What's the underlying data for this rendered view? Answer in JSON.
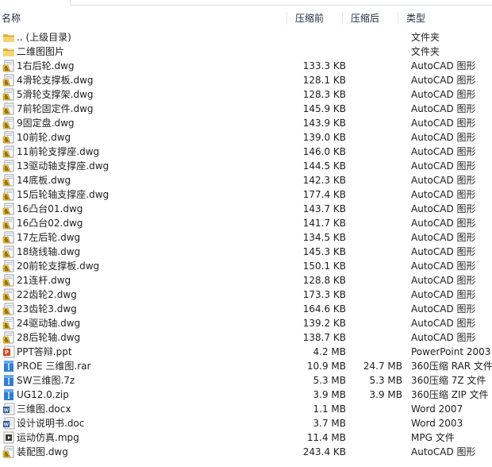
{
  "header": {
    "name": "名称",
    "size_before": "压缩前",
    "size_after": "压缩后",
    "type": "类型"
  },
  "rows": [
    {
      "name": ".. (上级目录)",
      "before": "",
      "after": "",
      "type": "文件夹",
      "icon": "folder-icon"
    },
    {
      "name": "二维图图片",
      "before": "",
      "after": "",
      "type": "文件夹",
      "icon": "folder-icon"
    },
    {
      "name": "1右后轮.dwg",
      "before": "133.3 KB",
      "after": "",
      "type": "AutoCAD 图形",
      "icon": "autocad-file-icon"
    },
    {
      "name": "4滑轮支撑板.dwg",
      "before": "128.1 KB",
      "after": "",
      "type": "AutoCAD 图形",
      "icon": "autocad-file-icon"
    },
    {
      "name": "5滑轮支撑架.dwg",
      "before": "128.3 KB",
      "after": "",
      "type": "AutoCAD 图形",
      "icon": "autocad-file-icon"
    },
    {
      "name": "7前轮固定件.dwg",
      "before": "145.9 KB",
      "after": "",
      "type": "AutoCAD 图形",
      "icon": "autocad-file-icon"
    },
    {
      "name": "9固定盘.dwg",
      "before": "143.9 KB",
      "after": "",
      "type": "AutoCAD 图形",
      "icon": "autocad-file-icon"
    },
    {
      "name": "10前轮.dwg",
      "before": "139.0 KB",
      "after": "",
      "type": "AutoCAD 图形",
      "icon": "autocad-file-icon"
    },
    {
      "name": "11前轮支撑座.dwg",
      "before": "146.0 KB",
      "after": "",
      "type": "AutoCAD 图形",
      "icon": "autocad-file-icon"
    },
    {
      "name": "13驱动轴支撑座.dwg",
      "before": "144.5 KB",
      "after": "",
      "type": "AutoCAD 图形",
      "icon": "autocad-file-icon"
    },
    {
      "name": "14底板.dwg",
      "before": "142.3 KB",
      "after": "",
      "type": "AutoCAD 图形",
      "icon": "autocad-file-icon"
    },
    {
      "name": "15后轮轴支撑座.dwg",
      "before": "177.4 KB",
      "after": "",
      "type": "AutoCAD 图形",
      "icon": "autocad-file-icon"
    },
    {
      "name": "16凸台01.dwg",
      "before": "143.7 KB",
      "after": "",
      "type": "AutoCAD 图形",
      "icon": "autocad-file-icon"
    },
    {
      "name": "16凸台02.dwg",
      "before": "141.7 KB",
      "after": "",
      "type": "AutoCAD 图形",
      "icon": "autocad-file-icon"
    },
    {
      "name": "17左后轮.dwg",
      "before": "134.5 KB",
      "after": "",
      "type": "AutoCAD 图形",
      "icon": "autocad-file-icon"
    },
    {
      "name": "18绕线轴.dwg",
      "before": "145.3 KB",
      "after": "",
      "type": "AutoCAD 图形",
      "icon": "autocad-file-icon"
    },
    {
      "name": "20前轮支撑板.dwg",
      "before": "150.1 KB",
      "after": "",
      "type": "AutoCAD 图形",
      "icon": "autocad-file-icon"
    },
    {
      "name": "21连杆.dwg",
      "before": "128.8 KB",
      "after": "",
      "type": "AutoCAD 图形",
      "icon": "autocad-file-icon"
    },
    {
      "name": "22齿轮2.dwg",
      "before": "173.3 KB",
      "after": "",
      "type": "AutoCAD 图形",
      "icon": "autocad-file-icon"
    },
    {
      "name": "23齿轮3.dwg",
      "before": "164.6 KB",
      "after": "",
      "type": "AutoCAD 图形",
      "icon": "autocad-file-icon"
    },
    {
      "name": "24驱动轴.dwg",
      "before": "139.2 KB",
      "after": "",
      "type": "AutoCAD 图形",
      "icon": "autocad-file-icon"
    },
    {
      "name": "28后轮轴.dwg",
      "before": "138.7 KB",
      "after": "",
      "type": "AutoCAD 图形",
      "icon": "autocad-file-icon"
    },
    {
      "name": "PPT答辩.ppt",
      "before": "4.2 MB",
      "after": "",
      "type": "PowerPoint 2003",
      "icon": "powerpoint-file-icon"
    },
    {
      "name": "PROE 三维图.rar",
      "before": "10.9 MB",
      "after": "24.7 MB",
      "type": "360压缩 RAR 文件",
      "icon": "archive-file-icon"
    },
    {
      "name": "SW三维图.7z",
      "before": "5.3 MB",
      "after": "5.3 MB",
      "type": "360压缩 7Z 文件",
      "icon": "archive-file-icon"
    },
    {
      "name": "UG12.0.zip",
      "before": "3.9 MB",
      "after": "3.9 MB",
      "type": "360压缩 ZIP 文件",
      "icon": "archive-file-icon"
    },
    {
      "name": "三维图.docx",
      "before": "1.1 MB",
      "after": "",
      "type": "Word 2007",
      "icon": "word-file-icon"
    },
    {
      "name": "设计说明书.doc",
      "before": "3.7 MB",
      "after": "",
      "type": "Word 2003",
      "icon": "word-file-icon"
    },
    {
      "name": "运动仿真.mpg",
      "before": "11.4 MB",
      "after": "",
      "type": "MPG 文件",
      "icon": "video-file-icon"
    },
    {
      "name": "装配图.dwg",
      "before": "243.4 KB",
      "after": "",
      "type": "AutoCAD 图形",
      "icon": "autocad-file-icon"
    }
  ]
}
